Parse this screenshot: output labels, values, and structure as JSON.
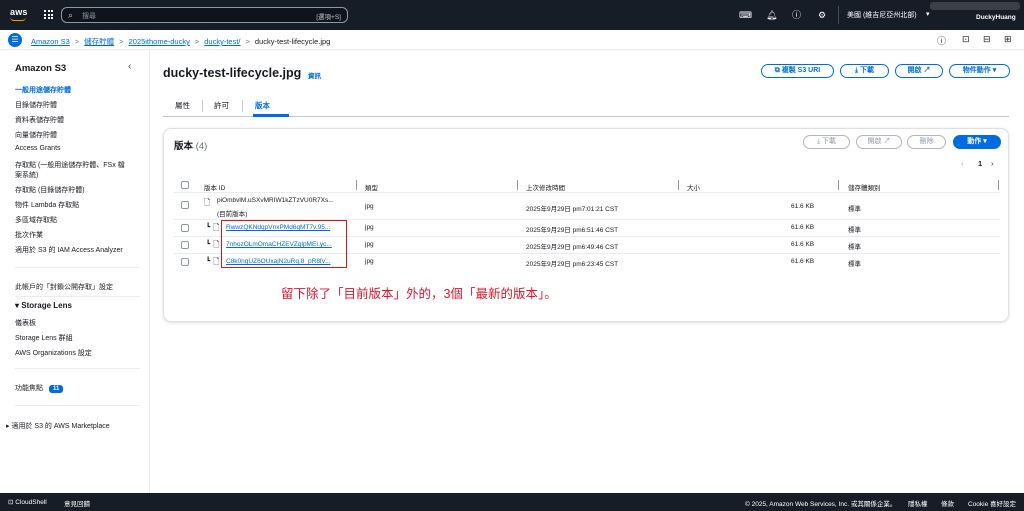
{
  "topbar": {
    "logo": "aws",
    "search_placeholder": "搜尋",
    "search_shortcut": "[選項+S]",
    "region": "美國 (維吉尼亞州北部)",
    "user": "DuckyHuang"
  },
  "breadcrumb": {
    "items": [
      "Amazon S3",
      "儲存貯體",
      "2025ithome-ducky",
      "ducky-test/"
    ],
    "current": "ducky-test-lifecycle.jpg"
  },
  "sidebar": {
    "title": "Amazon S3",
    "items": [
      "一般用途儲存貯體",
      "目錄儲存貯體",
      "資料表儲存貯體",
      "向量儲存貯體",
      "Access Grants",
      "存取點 (一般用途儲存貯體、FSx 檔",
      "案系統)",
      "存取點 (目錄儲存貯體)",
      "物件 Lambda 存取點",
      "多區域存取點",
      "批次作業",
      "適用於 S3 的 IAM Access Analyzer"
    ],
    "block_public": "此帳戶的「封鎖公開存取」設定",
    "storage_lens": {
      "title": "Storage Lens",
      "items": [
        "儀表板",
        "Storage Lens 群組",
        "AWS Organizations 設定"
      ]
    },
    "feature_spotlight": "功能焦點",
    "feature_count": "11",
    "marketplace": "適用於 S3 的 AWS Marketplace"
  },
  "page": {
    "title": "ducky-test-lifecycle.jpg",
    "info": "資訊",
    "actions": {
      "copy_uri": "複製 S3 URI",
      "download": "下載",
      "open": "開啟",
      "object_actions": "物件動作"
    },
    "tabs": [
      "屬性",
      "許可",
      "版本"
    ]
  },
  "versions": {
    "title": "版本",
    "count": "(4)",
    "buttons": {
      "download": "下載",
      "open": "開啟",
      "delete": "刪除",
      "actions": "動作"
    },
    "page": "1",
    "columns": [
      "版本 ID",
      "類型",
      "上次修改時間",
      "大小",
      "儲存體類別"
    ],
    "rows": [
      {
        "id": "piOmbvlM.uSXvMRIW1kZTzVU0R7Xs...",
        "sub": "(目前版本)",
        "type": "jpg",
        "modified": "2025年9月29日 pm7:01:21 CST",
        "size": "61.6 KB",
        "class": "標準"
      },
      {
        "id": "RwwzQKNdqpVnxPMd6qMT7v.95...",
        "sub": "",
        "type": "jpg",
        "modified": "2025年9月29日 pm6:51:46 CST",
        "size": "61.6 KB",
        "class": "標準"
      },
      {
        "id": "7nhozOLmOmaCHZEVZqlpMEI.yc...",
        "sub": "",
        "type": "jpg",
        "modified": "2025年9月29日 pm6:49:46 CST",
        "size": "61.6 KB",
        "class": "標準"
      },
      {
        "id": "C8k0ngUZ6OUxajN2uRq.8_pR8lV...",
        "sub": "",
        "type": "jpg",
        "modified": "2025年9月29日 pm6:23:45 CST",
        "size": "61.6 KB",
        "class": "標準"
      }
    ]
  },
  "annotation": "留下除了「目前版本」外的，3個「最新的版本」。",
  "footer": {
    "cloudshell": "CloudShell",
    "feedback": "意見回饋",
    "copyright": "© 2025, Amazon Web Services, Inc. 或其關係企業。",
    "privacy": "隱私權",
    "terms": "條款",
    "cookie": "Cookie 喜好設定"
  },
  "colors": {
    "accent": "#006ce0",
    "topbar": "#161d26",
    "annotation": "#e0152d"
  }
}
